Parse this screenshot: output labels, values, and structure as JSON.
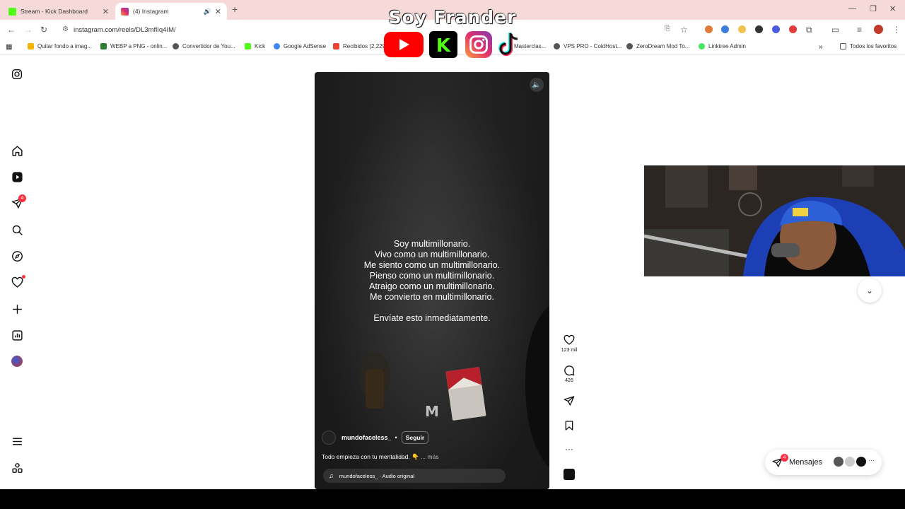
{
  "browser": {
    "tabs": [
      {
        "title": "Stream - Kick Dashboard"
      },
      {
        "title": "(4) Instagram"
      }
    ],
    "url": "instagram.com/reels/DL3mflIq4IM/",
    "bookmarks": [
      "Quitar fondo a imag...",
      "WEBP a PNG - onlin...",
      "Convertidor de You...",
      "Kick",
      "Google AdSense",
      "Recibidos (2,229",
      "Masterclas...",
      "VPS PRO - ColdHost...",
      "ZeroDream Mod To...",
      "Linktree Admin"
    ],
    "all_bookmarks_label": "Todos los favoritos"
  },
  "overlay": {
    "title": "Soy Frander"
  },
  "sidebar": {
    "notification_count": "4"
  },
  "reel": {
    "lines": [
      "Soy multimillonario.",
      "Vivo como un multimillonario.",
      "Me siento como un multimillonario.",
      "Pienso como un multimillonario.",
      "Atraigo como un multimillonario.",
      "Me convierto en multimillonario."
    ],
    "cta": "Envíate esto inmediatamente.",
    "author": "mundofaceless_",
    "separator": "•",
    "follow_label": "Seguir",
    "caption": "Todo empieza con tu mentalidad. 👇",
    "more_label": "... más",
    "audio": "mundofaceless_ · Audio original"
  },
  "actions": {
    "likes": "123 mil",
    "comments": "426"
  },
  "messages": {
    "label": "Mensajes",
    "badge": "4"
  },
  "colors": {
    "brand_badge": "#ff3040",
    "tab_strip": "#f6dada"
  }
}
